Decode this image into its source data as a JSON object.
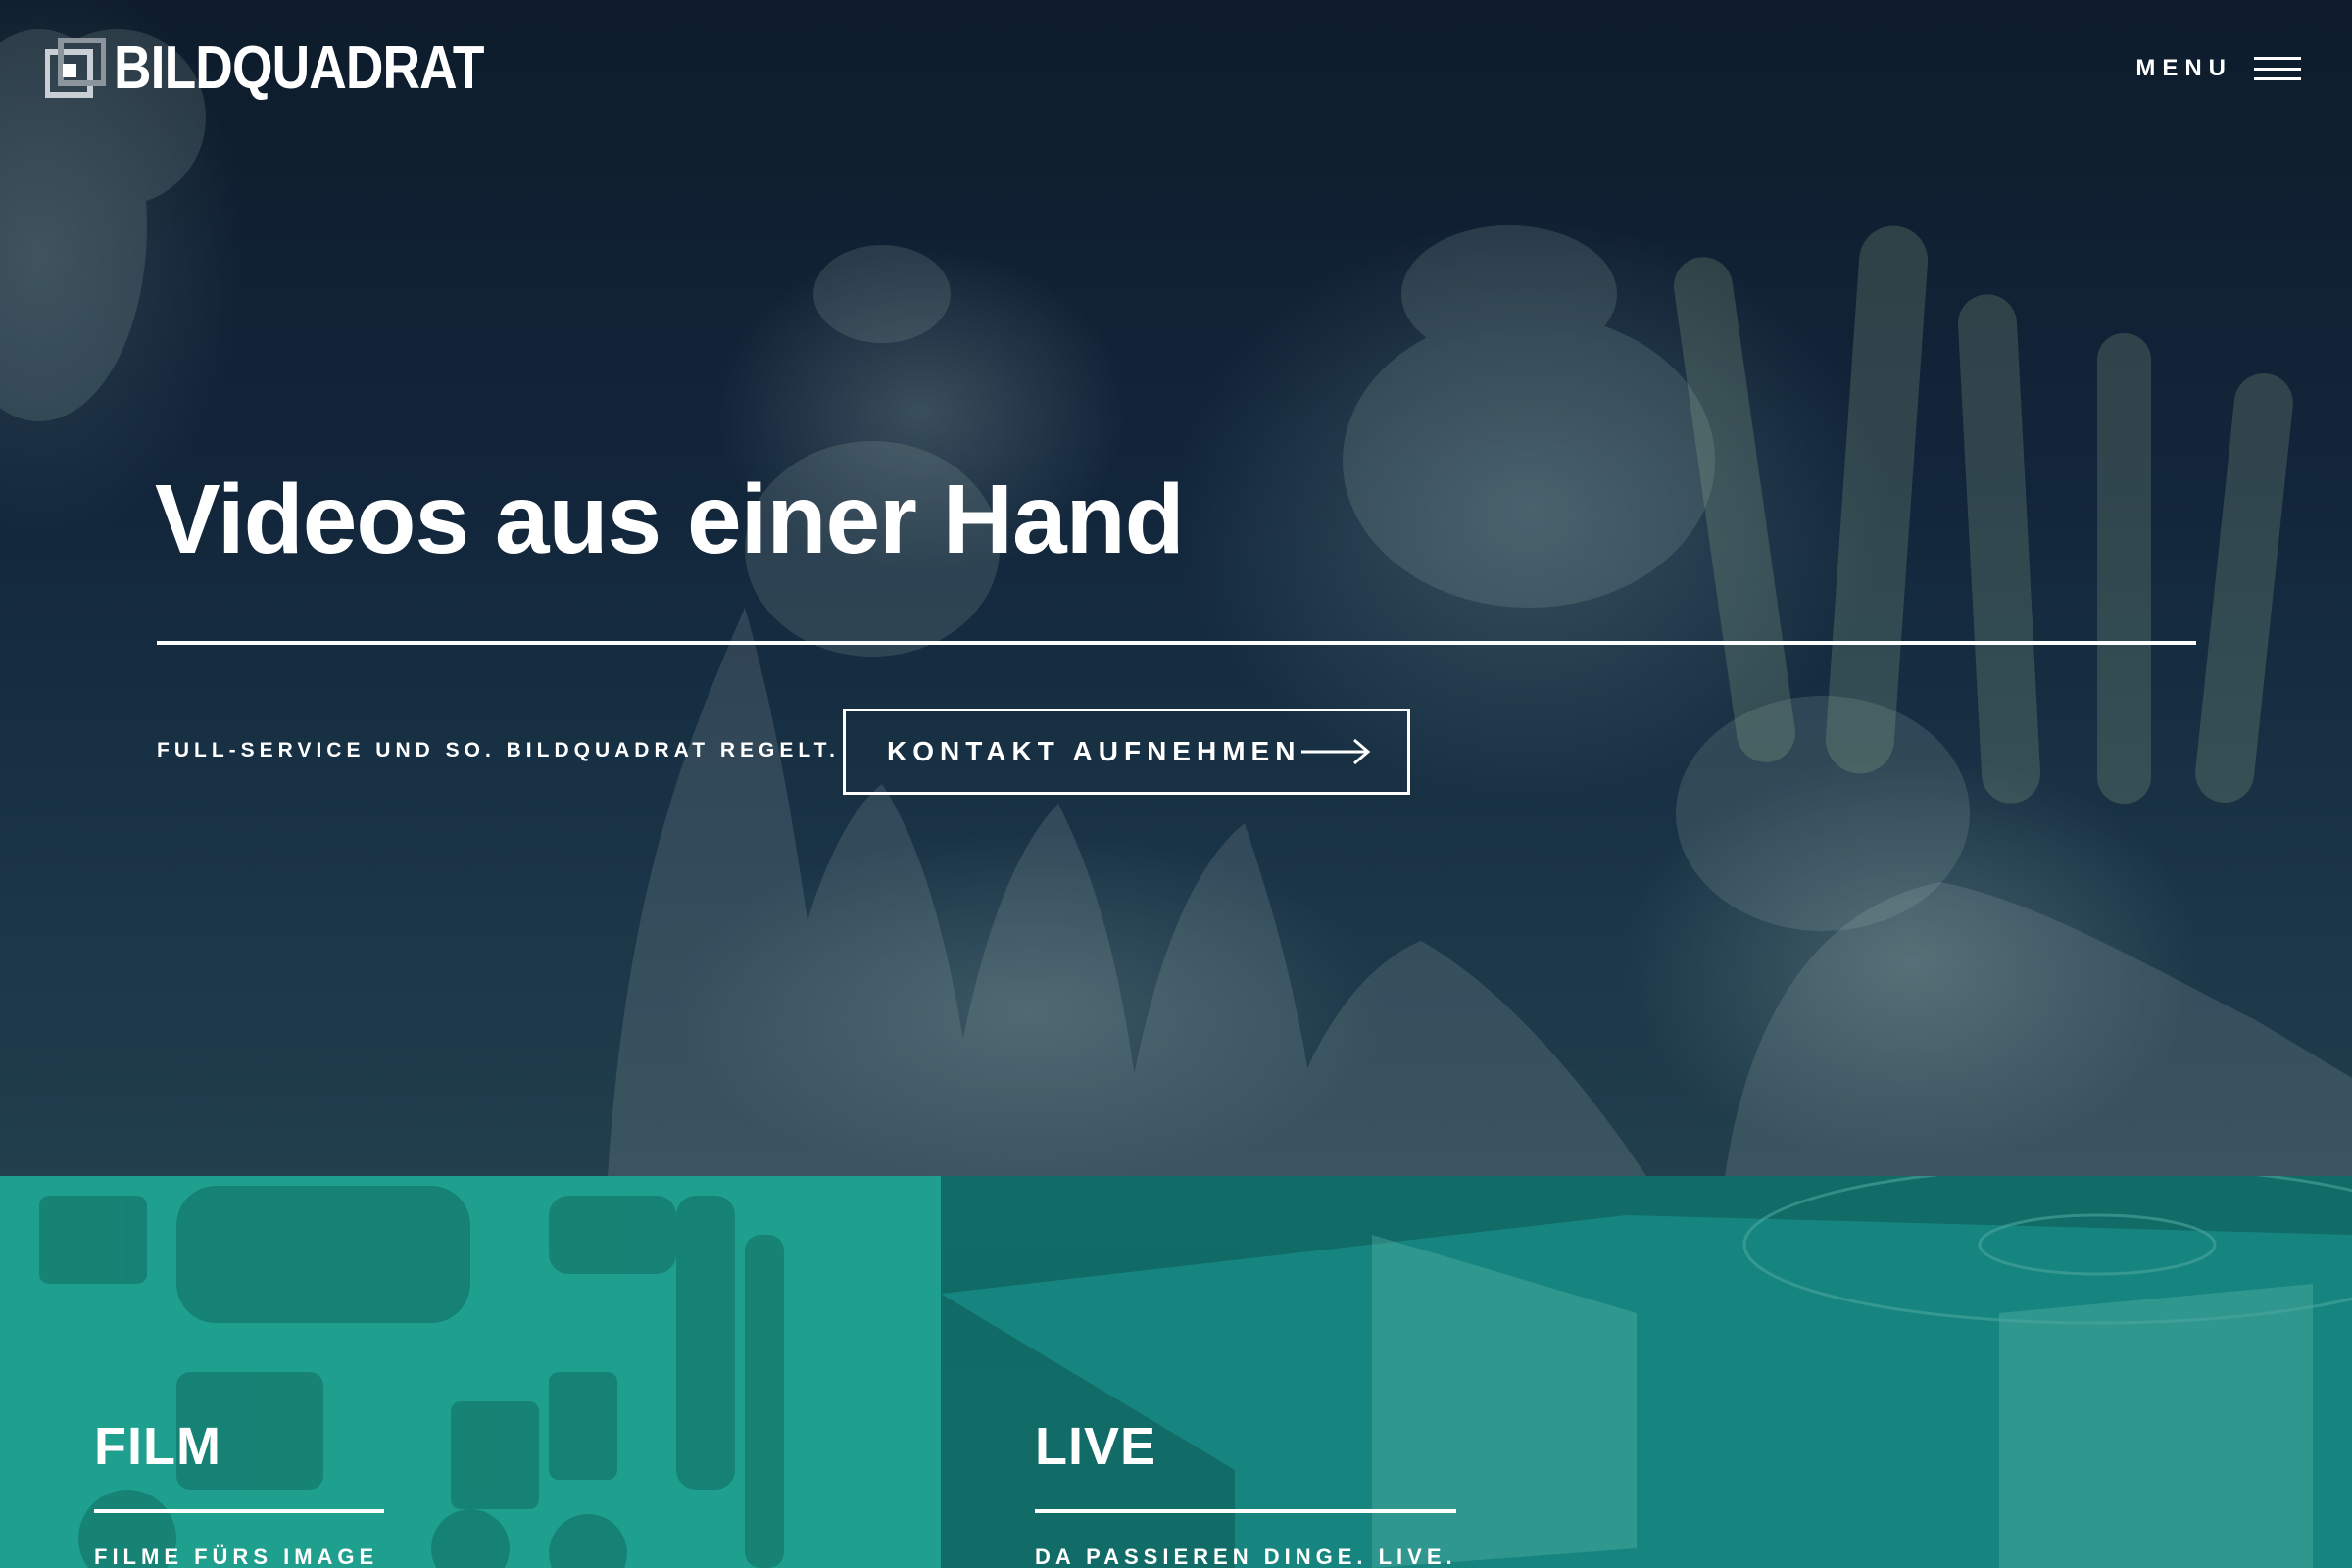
{
  "brand": {
    "name": "BILDQUADRAT",
    "logo_icon": "square-logo-icon"
  },
  "header": {
    "menu_label": "MENU",
    "menu_icon": "hamburger-icon"
  },
  "hero": {
    "title": "Videos aus einer Hand",
    "tagline": "FULL-SERVICE UND SO. BILDQUADRAT REGELT.",
    "cta_label": "KONTAKT AUFNEHMEN",
    "cta_icon": "arrow-right-icon",
    "background": "jellyfish aquarium photo",
    "overlay_color": "#0f1e2c"
  },
  "tiles": [
    {
      "title": "FILM",
      "subtitle": "FILME FÜRS IMAGE",
      "overlay_color": "#1fa08f"
    },
    {
      "title": "LIVE",
      "subtitle": "DA PASSIEREN DINGE. LIVE.",
      "overlay_color": "#17857f"
    }
  ]
}
